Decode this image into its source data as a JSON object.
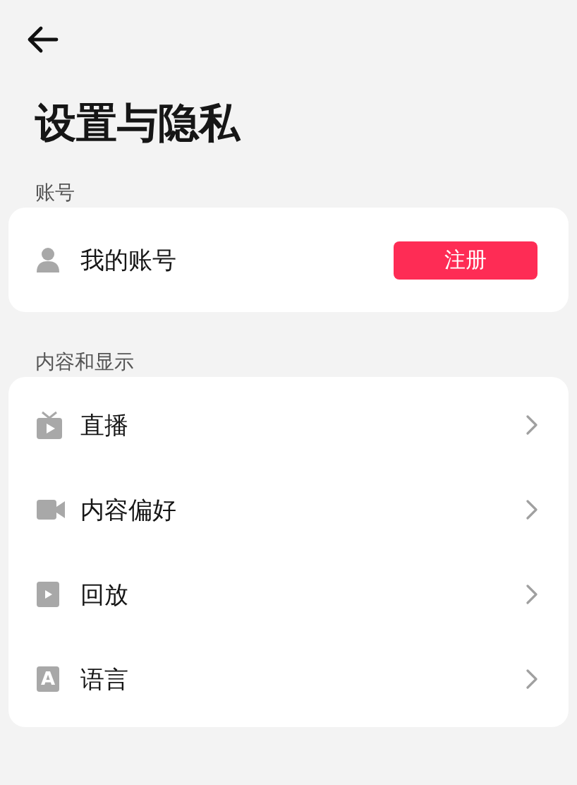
{
  "title": "设置与隐私",
  "sections": [
    {
      "label": "账号",
      "items": [
        {
          "kind": "account",
          "label": "我的账号",
          "button": "注册"
        }
      ]
    },
    {
      "label": "内容和显示",
      "items": [
        {
          "kind": "link",
          "label": "直播"
        },
        {
          "kind": "link",
          "label": "内容偏好"
        },
        {
          "kind": "link",
          "label": "回放"
        },
        {
          "kind": "link",
          "icon_text": "A",
          "label": "语言"
        }
      ]
    }
  ]
}
